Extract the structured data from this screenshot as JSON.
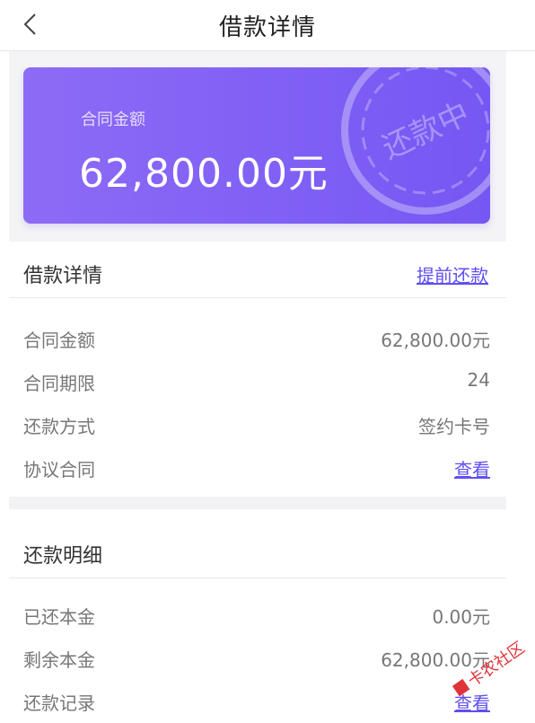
{
  "header": {
    "title": "借款详情"
  },
  "card": {
    "label": "合同金额",
    "amount": "62,800.00元",
    "stamp_text": "还款中",
    "accent": "#8161f5"
  },
  "loan_section": {
    "title": "借款详情",
    "action": "提前还款",
    "rows": [
      {
        "key": "合同金额",
        "value": "62,800.00元"
      },
      {
        "key": "合同期限",
        "value": "24"
      },
      {
        "key": "还款方式",
        "value": "签约卡号"
      },
      {
        "key": "协议合同",
        "value": "查看"
      }
    ]
  },
  "repay_section": {
    "title": "还款明细",
    "rows": [
      {
        "key": "已还本金",
        "value": "0.00元"
      },
      {
        "key": "剩余本金",
        "value": "62,800.00元"
      },
      {
        "key": "还款记录",
        "value": "查看"
      }
    ]
  },
  "watermark": {
    "text": "卡农社区"
  }
}
